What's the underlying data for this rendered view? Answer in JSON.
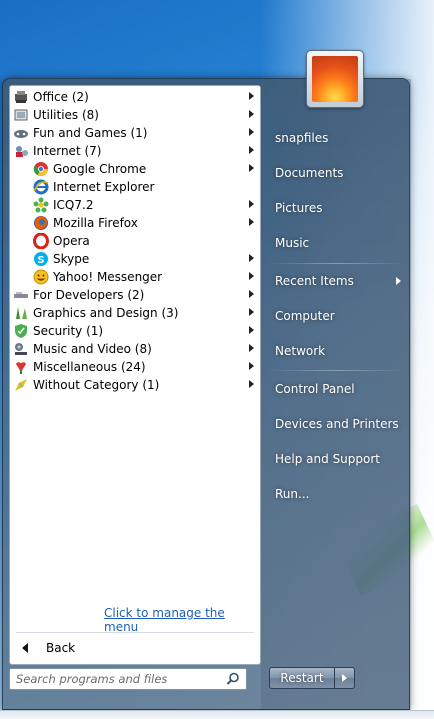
{
  "programs": [
    {
      "label": "Office (2)",
      "icon": "office-icon",
      "submenu": true,
      "indent": false
    },
    {
      "label": "Utilities (8)",
      "icon": "utilities-icon",
      "submenu": true,
      "indent": false
    },
    {
      "label": "Fun and Games (1)",
      "icon": "games-icon",
      "submenu": true,
      "indent": false
    },
    {
      "label": "Internet (7)",
      "icon": "internet-icon",
      "submenu": true,
      "indent": false
    },
    {
      "label": "Google Chrome",
      "icon": "chrome-icon",
      "submenu": true,
      "indent": true
    },
    {
      "label": "Internet Explorer",
      "icon": "ie-icon",
      "submenu": false,
      "indent": true
    },
    {
      "label": "ICQ7.2",
      "icon": "icq-icon",
      "submenu": true,
      "indent": true
    },
    {
      "label": "Mozilla Firefox",
      "icon": "firefox-icon",
      "submenu": true,
      "indent": true
    },
    {
      "label": "Opera",
      "icon": "opera-icon",
      "submenu": false,
      "indent": true
    },
    {
      "label": "Skype",
      "icon": "skype-icon",
      "submenu": true,
      "indent": true
    },
    {
      "label": "Yahoo! Messenger",
      "icon": "yahoo-icon",
      "submenu": true,
      "indent": true
    },
    {
      "label": "For Developers (2)",
      "icon": "developers-icon",
      "submenu": true,
      "indent": false
    },
    {
      "label": "Graphics and Design (3)",
      "icon": "graphics-icon",
      "submenu": true,
      "indent": false
    },
    {
      "label": "Security (1)",
      "icon": "security-icon",
      "submenu": true,
      "indent": false
    },
    {
      "label": "Music and Video (8)",
      "icon": "music-icon",
      "submenu": true,
      "indent": false
    },
    {
      "label": "Miscellaneous (24)",
      "icon": "misc-icon",
      "submenu": true,
      "indent": false
    },
    {
      "label": "Without Category (1)",
      "icon": "uncategorized-icon",
      "submenu": true,
      "indent": false
    }
  ],
  "manage_link": "Click to manage the menu",
  "back_label": "Back",
  "search": {
    "placeholder": "Search programs and files"
  },
  "right_pane": {
    "snapfiles": "snapfiles",
    "documents": "Documents",
    "pictures": "Pictures",
    "music": "Music",
    "recent_items": "Recent Items",
    "computer": "Computer",
    "network": "Network",
    "control_panel": "Control Panel",
    "devices_printers": "Devices and Printers",
    "help_support": "Help and Support",
    "run": "Run..."
  },
  "restart_label": "Restart"
}
